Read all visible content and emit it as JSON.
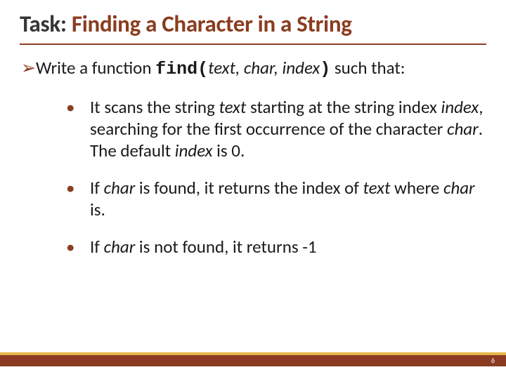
{
  "title": {
    "prefix": "Task: ",
    "main": "Finding a Character in a String"
  },
  "intro": {
    "pre": "Write a function ",
    "fn": "find",
    "paren_open": "(",
    "args": "text, char, index",
    "paren_close": ")",
    "post": " such that:"
  },
  "items": [
    {
      "parts": [
        {
          "t": "It scans the string "
        },
        {
          "t": "text",
          "i": true
        },
        {
          "t": " starting at the string index "
        },
        {
          "t": "index",
          "i": true
        },
        {
          "t": ", searching for the first occurrence of the character "
        },
        {
          "t": "char",
          "i": true
        },
        {
          "t": ".  The default "
        },
        {
          "t": "index",
          "i": true
        },
        {
          "t": " is 0."
        }
      ]
    },
    {
      "parts": [
        {
          "t": "If "
        },
        {
          "t": "char",
          "i": true
        },
        {
          "t": " is found, it returns the index of "
        },
        {
          "t": "text",
          "i": true
        },
        {
          "t": " where "
        },
        {
          "t": "char",
          "i": true
        },
        {
          "t": " is."
        }
      ]
    },
    {
      "parts": [
        {
          "t": "If "
        },
        {
          "t": "char",
          "i": true
        },
        {
          "t": " is not found, it returns -1"
        }
      ]
    }
  ],
  "page_number": "6",
  "bullets": {
    "arrow": "➢",
    "dot": "•"
  }
}
